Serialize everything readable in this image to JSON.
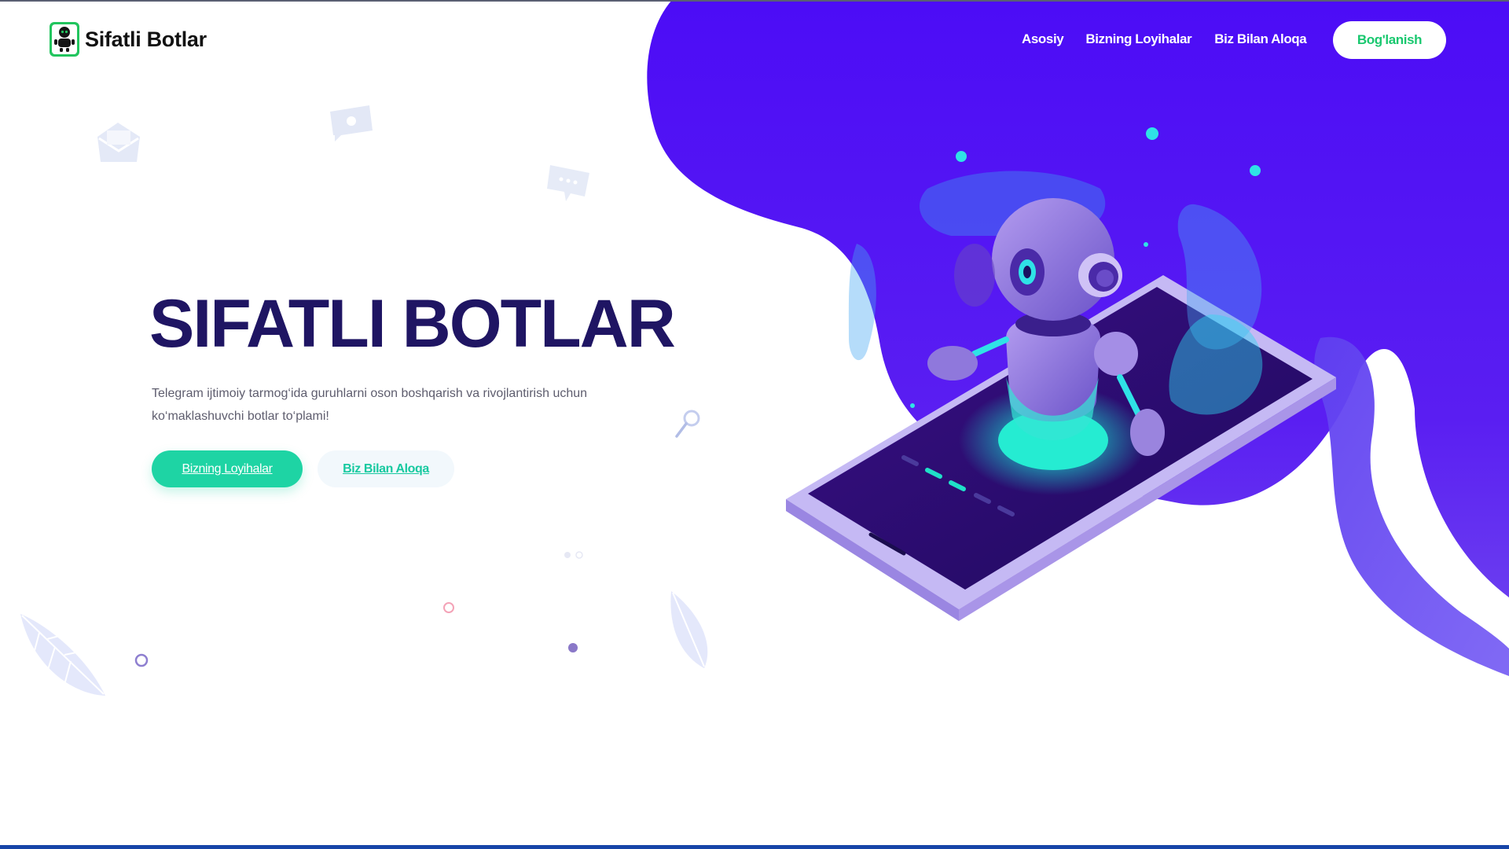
{
  "brand": {
    "name": "Sifatli Botlar",
    "logo_icon": "robot-icon",
    "logo_color": "#22c55e"
  },
  "nav": {
    "items": [
      {
        "label": "Asosiy"
      },
      {
        "label": "Bizning Loyihalar"
      },
      {
        "label": "Biz Bilan Aloqa"
      }
    ],
    "cta_label": "Bog'lanish"
  },
  "hero": {
    "title": "SIFATLI BOTLAR",
    "description": "Telegram ijtimoiy tarmog‘ida guruhlarni oson boshqarish va rivojlantirish uchun ko‘maklashuvchi botlar to‘plami!",
    "primary_button": "Bizning Loyihalar",
    "secondary_button": "Biz Bilan Aloqa"
  },
  "colors": {
    "accent": "#1ed4a4",
    "blob": "#5110f5",
    "title": "#1f1563",
    "cta_text": "#19c86f"
  }
}
